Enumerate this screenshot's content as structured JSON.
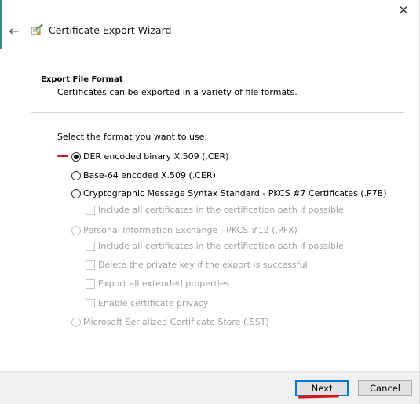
{
  "window": {
    "title": "Certificate Export Wizard",
    "close_glyph": "✕",
    "back_glyph": "←",
    "icons": {
      "close": "close-icon",
      "back": "back-arrow-icon",
      "wizard": "certificate-wizard-icon"
    }
  },
  "header": {
    "section_title": "Export File Format",
    "section_description": "Certificates can be exported in a variety of file formats."
  },
  "format": {
    "prompt": "Select the format you want to use:",
    "options": [
      {
        "label": "DER encoded binary X.509 (.CER)",
        "checked": true,
        "enabled": true
      },
      {
        "label": "Base-64 encoded X.509 (.CER)",
        "checked": false,
        "enabled": true
      },
      {
        "label": "Cryptographic Message Syntax Standard - PKCS #7 Certificates (.P7B)",
        "checked": false,
        "enabled": true
      },
      {
        "label": "Personal Information Exchange - PKCS #12 (.PFX)",
        "checked": false,
        "enabled": false
      },
      {
        "label": "Microsoft Serialized Certificate Store (.SST)",
        "checked": false,
        "enabled": false
      }
    ],
    "p7b_options": [
      {
        "label": "Include all certificates in the certification path if possible",
        "checked": false,
        "enabled": false
      }
    ],
    "pfx_options": [
      {
        "label": "Include all certificates in the certification path if possible",
        "checked": false,
        "enabled": false
      },
      {
        "label": "Delete the private key if the export is successful",
        "checked": false,
        "enabled": false
      },
      {
        "label": "Export all extended properties",
        "checked": false,
        "enabled": false
      },
      {
        "label": "Enable certificate privacy",
        "checked": false,
        "enabled": false
      }
    ]
  },
  "footer": {
    "next_label": "Next",
    "cancel_label": "Cancel"
  },
  "colors": {
    "accent": "#0078d7",
    "annotation_red": "#d01818",
    "disabled_text": "#a0a0a0",
    "footer_bg": "#f0f0f0"
  }
}
